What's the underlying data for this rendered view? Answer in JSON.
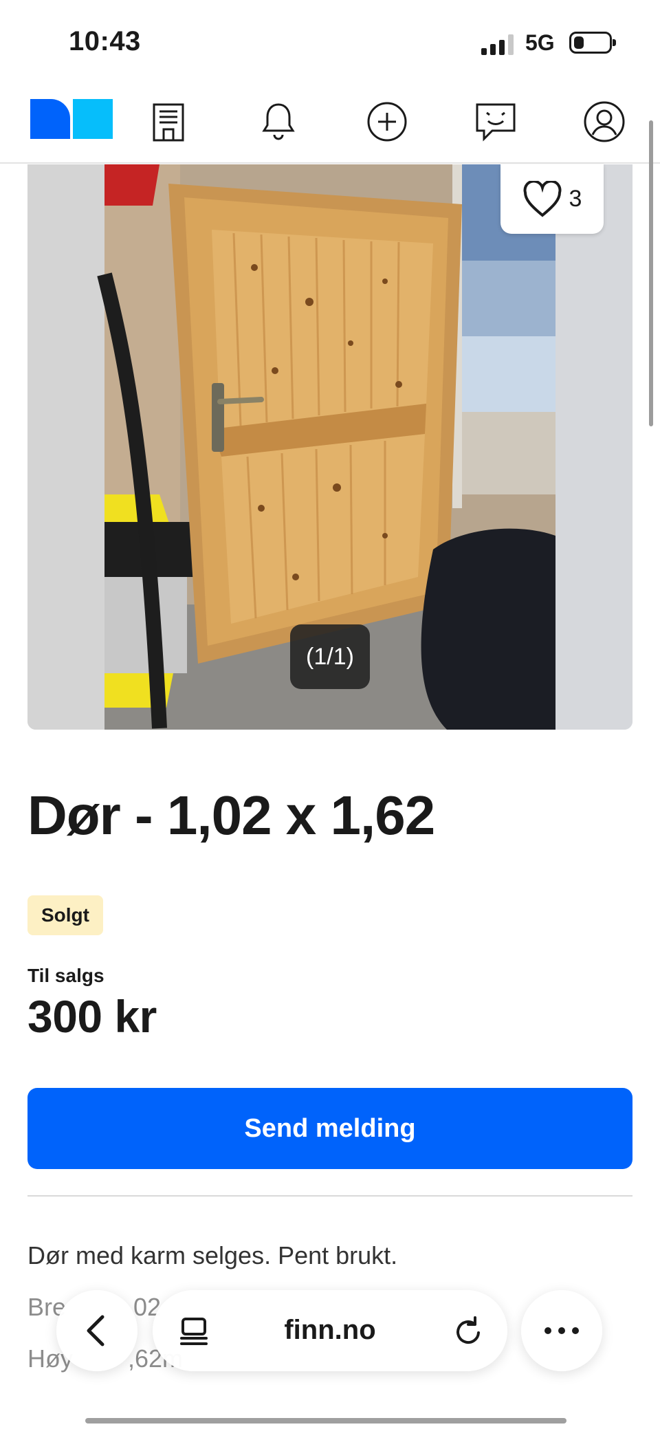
{
  "status_bar": {
    "time": "10:43",
    "network": "5G",
    "battery_level": 0.3,
    "signal_bars_active": 3,
    "signal_bars_total": 4
  },
  "nav": {
    "logo": "finn-logo",
    "icons": [
      "building-icon",
      "bell-icon",
      "plus-circle-icon",
      "chat-icon",
      "profile-icon"
    ]
  },
  "gallery": {
    "favorite_count": "3",
    "image_counter": "(1/1)"
  },
  "listing": {
    "title": "Dør - 1,02 x 1,62",
    "status_badge": "Solgt",
    "price_label": "Til salgs",
    "price": "300 kr",
    "send_button": "Send melding",
    "description": "Dør med karm selges. Pent brukt.",
    "detail_lines": [
      "Bre",
      "02",
      "Høy",
      ",62m"
    ]
  },
  "browser": {
    "url": "finn.no"
  },
  "colors": {
    "primary": "#0063fb",
    "logo_secondary": "#06befb",
    "badge_bg": "#fdf0c4"
  }
}
